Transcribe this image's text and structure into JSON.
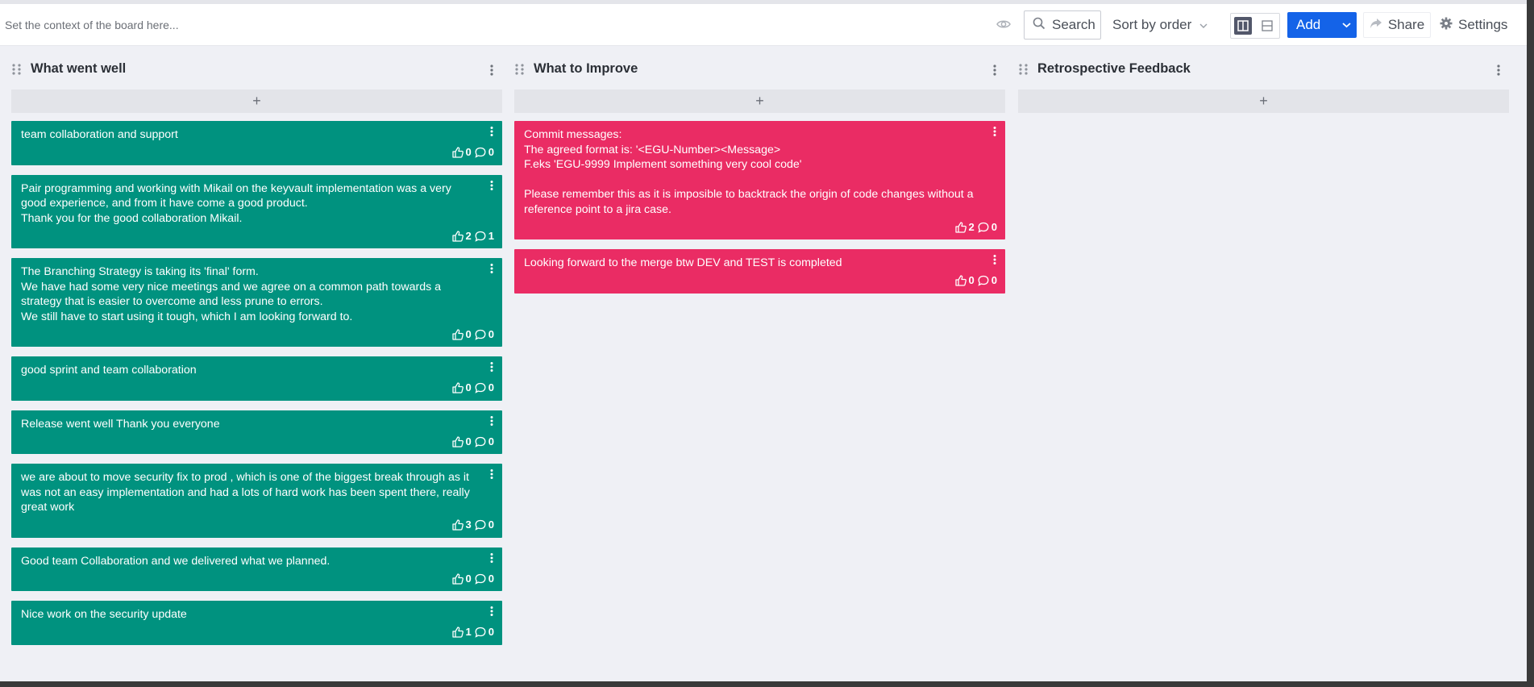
{
  "toolbar": {
    "context_placeholder": "Set the context of the board here...",
    "search_label": "Search",
    "sort_label": "Sort by order",
    "add_label": "Add",
    "share_label": "Share",
    "settings_label": "Settings"
  },
  "colors": {
    "went_well": "#00927f",
    "improve": "#ea2c64",
    "accent": "#1463e8"
  },
  "columns": [
    {
      "title": "What went well",
      "cards": [
        {
          "text": "team collaboration and support",
          "likes": "0",
          "comments": "0"
        },
        {
          "text": "Pair programming and working with Mikail on the keyvault implementation was a very good experience, and from it have come a good product.\nThank you for the good collaboration Mikail.",
          "likes": "2",
          "comments": "1"
        },
        {
          "text": "The Branching Strategy is taking its 'final' form.\nWe have had some very nice meetings and we agree on a common path towards a strategy that is easier to overcome and less prune to errors.\nWe still have to start using it tough, which I am looking forward to.",
          "likes": "0",
          "comments": "0"
        },
        {
          "text": "good sprint and team collaboration",
          "likes": "0",
          "comments": "0"
        },
        {
          "text": "Release went well Thank you everyone",
          "likes": "0",
          "comments": "0"
        },
        {
          "text": "we are about to move security fix to prod , which is one of the biggest break through as it was not an easy implementation and had a lots of hard work has been spent there, really great work",
          "likes": "3",
          "comments": "0"
        },
        {
          "text": "Good team Collaboration and we delivered what we planned.",
          "likes": "0",
          "comments": "0"
        },
        {
          "text": "Nice work on the security update",
          "likes": "1",
          "comments": "0"
        }
      ]
    },
    {
      "title": "What to Improve",
      "cards": [
        {
          "text": "Commit messages:\nThe agreed format is: '<EGU-Number><Message>\nF.eks 'EGU-9999 Implement something very cool code'\n\nPlease remember this as it is imposible to backtrack the origin of code changes without a reference point to a jira case.",
          "likes": "2",
          "comments": "0"
        },
        {
          "text": "Looking forward to the merge btw DEV and TEST is completed",
          "likes": "0",
          "comments": "0"
        }
      ]
    },
    {
      "title": "Retrospective Feedback",
      "cards": []
    }
  ]
}
